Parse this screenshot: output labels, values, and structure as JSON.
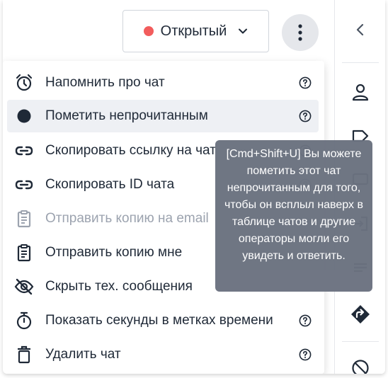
{
  "header": {
    "status_label": "Открытый",
    "status_color": "#f25c5c"
  },
  "menu": {
    "items": [
      {
        "label": "Напомнить про чат",
        "icon": "alarm-clock-icon",
        "help": true
      },
      {
        "label": "Пометить непрочитанным",
        "icon": "filled-circle-icon",
        "help": true,
        "active": true
      },
      {
        "label": "Скопировать ссылку на чат",
        "icon": "link-icon",
        "help": true
      },
      {
        "label": "Скопировать ID чата",
        "icon": "link-icon",
        "help": true
      },
      {
        "label": "Отправить копию на email",
        "icon": "clipboard-icon",
        "help": true,
        "disabled": true
      },
      {
        "label": "Отправить копию мне",
        "icon": "clipboard-icon",
        "help": true
      },
      {
        "label": "Скрыть тех. сообщения",
        "icon": "eye-off-icon",
        "help": true
      },
      {
        "label": "Показать секунды в метках времени",
        "icon": "stopwatch-icon",
        "help": true
      },
      {
        "label": "Удалить чат",
        "icon": "trash-icon",
        "help": true
      }
    ]
  },
  "tooltip": {
    "text": "[Cmd+Shift+U] Вы можете пометить этот чат непрочитанным для того, чтобы он всплыл наверх в таблице чатов и другие операторы могли его увидеть и ответить."
  },
  "sidebar": {
    "icons": [
      "chevron-left-icon",
      "person-icon",
      "tag-icon",
      "message-icon",
      "login-icon",
      "list-icon",
      "forward-icon",
      "block-icon"
    ]
  }
}
